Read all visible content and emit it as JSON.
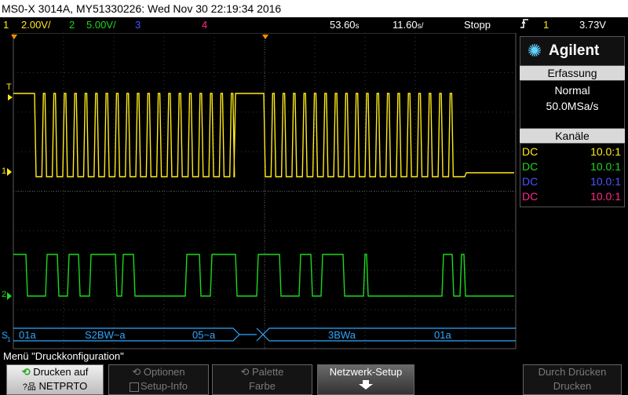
{
  "title": "MS0-X 3014A, MY51330226: Wed Nov 30 22:19:34 2016",
  "status": {
    "ch1_num": "1",
    "ch1_scale": "2.00V/",
    "ch2_num": "2",
    "ch2_scale": "5.00V/",
    "ch3_num": "3",
    "ch4_num": "4",
    "delay": "53.60",
    "delay_unit": "s",
    "timebase": "11.60",
    "timebase_unit": "s/",
    "run_state": "Stopp",
    "trigger_icon": "rising-edge-icon",
    "trigger_ch": "1",
    "trigger_level": "3.73V"
  },
  "colors": {
    "ch1": "#ffeb1a",
    "ch2": "#1bd91b",
    "ch3": "#4a55ff",
    "ch4": "#ff2a8a",
    "decode": "#2ea8ff",
    "trigger_marker": "#ff8c00"
  },
  "markers": {
    "ch1_ref": "1",
    "ch2_ref": "2",
    "trigger_level_marker": "T",
    "serial_label": "S",
    "serial_sub": "1"
  },
  "decode": {
    "segments": [
      "01a",
      "S2BW~a",
      "05~a",
      "3BWa",
      "01a"
    ]
  },
  "panel": {
    "brand": "Agilent",
    "acquisition": {
      "title": "Erfassung",
      "mode": "Normal",
      "rate": "50.0MSa/s"
    },
    "channels": {
      "title": "Kanäle",
      "rows": [
        {
          "coupling": "DC",
          "probe": "10.0:1",
          "color": "#ffeb1a"
        },
        {
          "coupling": "DC",
          "probe": "10.0:1",
          "color": "#1bd91b"
        },
        {
          "coupling": "DC",
          "probe": "10.0:1",
          "color": "#4a55ff"
        },
        {
          "coupling": "DC",
          "probe": "10.0:1",
          "color": "#ff2a8a"
        }
      ]
    }
  },
  "menu": {
    "label": "Menü \"Druckkonfiguration\"",
    "softkeys": [
      {
        "line1": "Drucken auf",
        "line2": "NETPRTO",
        "icon": "network-icon"
      },
      {
        "line1": "Optionen",
        "line2": "Setup-Info"
      },
      {
        "line1": "Palette",
        "line2": "Farbe"
      },
      {
        "line1": "Netzwerk-Setup",
        "icon": "down-arrow-icon"
      },
      {
        "line1": "Durch Drücken",
        "line2": "Drucken"
      }
    ]
  }
}
